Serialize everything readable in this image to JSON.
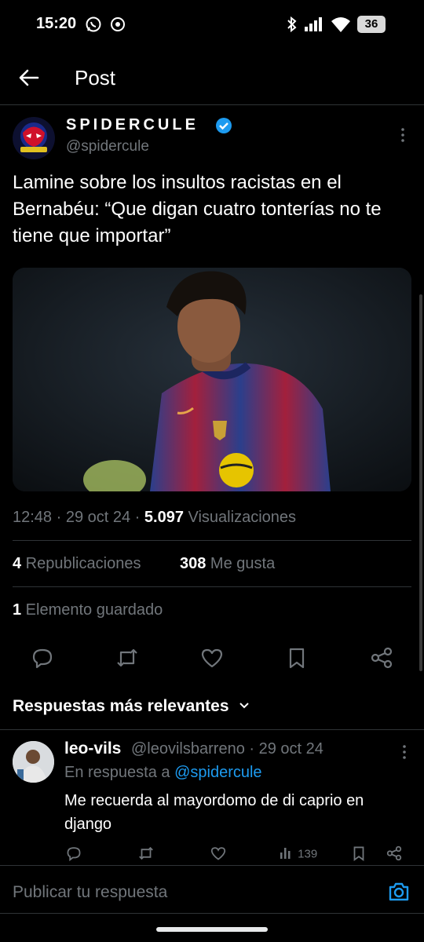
{
  "status": {
    "time": "15:20",
    "battery": "36"
  },
  "header": {
    "title": "Post"
  },
  "post": {
    "author_name": "SPIDERCULE",
    "handle": "@spidercule",
    "text": "Lamine sobre los insultos racistas en el Bernabéu: “Que digan cuatro tonterías no te tiene que importar”",
    "time": "12:48 · 29 oct 24 · ",
    "views_count": "5.097",
    "views_label": " Visualizaciones",
    "reposts_count": "4",
    "reposts_label": " Republicaciones",
    "likes_count": "308",
    "likes_label": " Me gusta",
    "bookmarks_count": "1",
    "bookmarks_label": " Elemento guardado"
  },
  "replies_sort": {
    "label": "Respuestas más relevantes"
  },
  "reply": {
    "name": "leo-vils",
    "handle_date": "@leovilsbarreno · 29 oct 24",
    "in_reply_prefix": "En respuesta a ",
    "in_reply_handle": "@spidercule",
    "text": "Me recuerda al mayordomo de di caprio en django",
    "views": "139"
  },
  "composer": {
    "placeholder": "Publicar tu respuesta"
  },
  "colors": {
    "accent": "#1d9bf0",
    "muted": "#71767b",
    "divider": "#2f3336"
  }
}
